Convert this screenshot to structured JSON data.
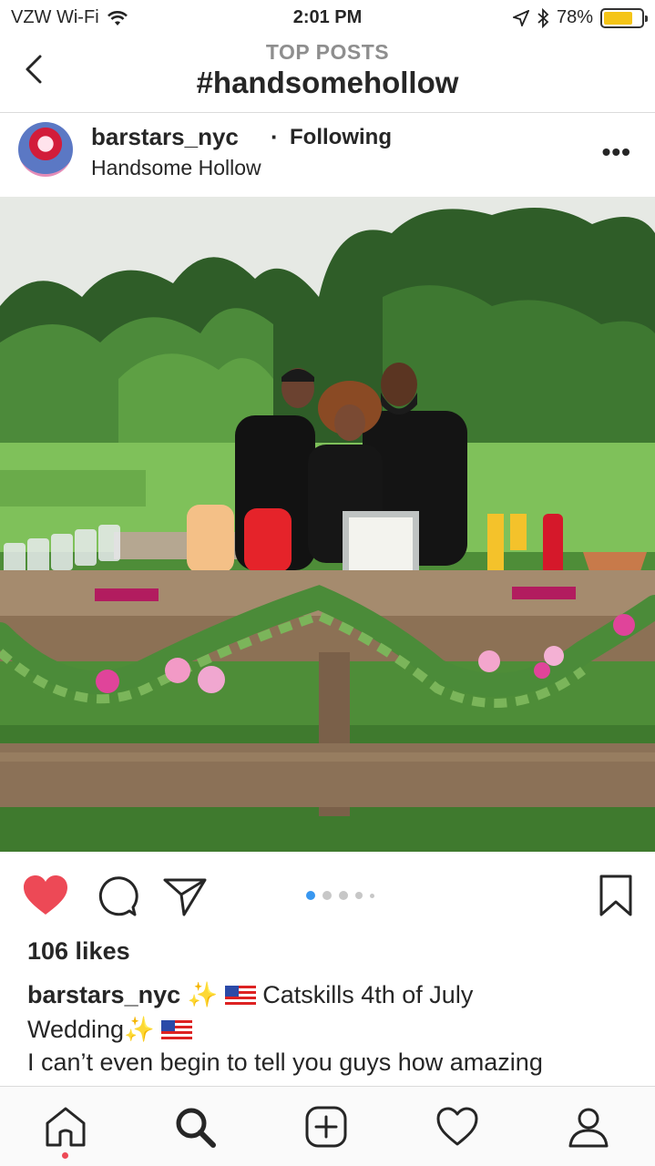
{
  "status_bar": {
    "carrier": "VZW Wi-Fi",
    "time": "2:01 PM",
    "battery_percent": "78%",
    "battery_level": 0.78,
    "icons": [
      "wifi-icon",
      "location-arrow-icon",
      "bluetooth-icon",
      "battery-icon"
    ]
  },
  "header": {
    "kicker": "TOP POSTS",
    "title": "#handsomehollow"
  },
  "post": {
    "username": "barstars_nyc",
    "separator": "·",
    "follow_status": "Following",
    "location": "Handsome Hollow",
    "more_label": "•••",
    "likes": "106 likes",
    "carousel": {
      "count": 5,
      "active_index": 0
    },
    "caption": {
      "username": "barstars_nyc",
      "line1_text": " ✨ ",
      "line1_rest": " Catskills 4th of July",
      "line2_text": "Wedding✨ ",
      "line3_text": "I can’t even begin to tell you guys how amazing"
    }
  },
  "colors": {
    "like_red": "#ed4956",
    "accent_blue": "#3897f0",
    "text": "#262626",
    "muted": "#8e8e8e"
  },
  "tabbar": {
    "items": [
      "home-icon",
      "search-icon",
      "add-post-icon",
      "activity-heart-icon",
      "profile-icon"
    ]
  }
}
